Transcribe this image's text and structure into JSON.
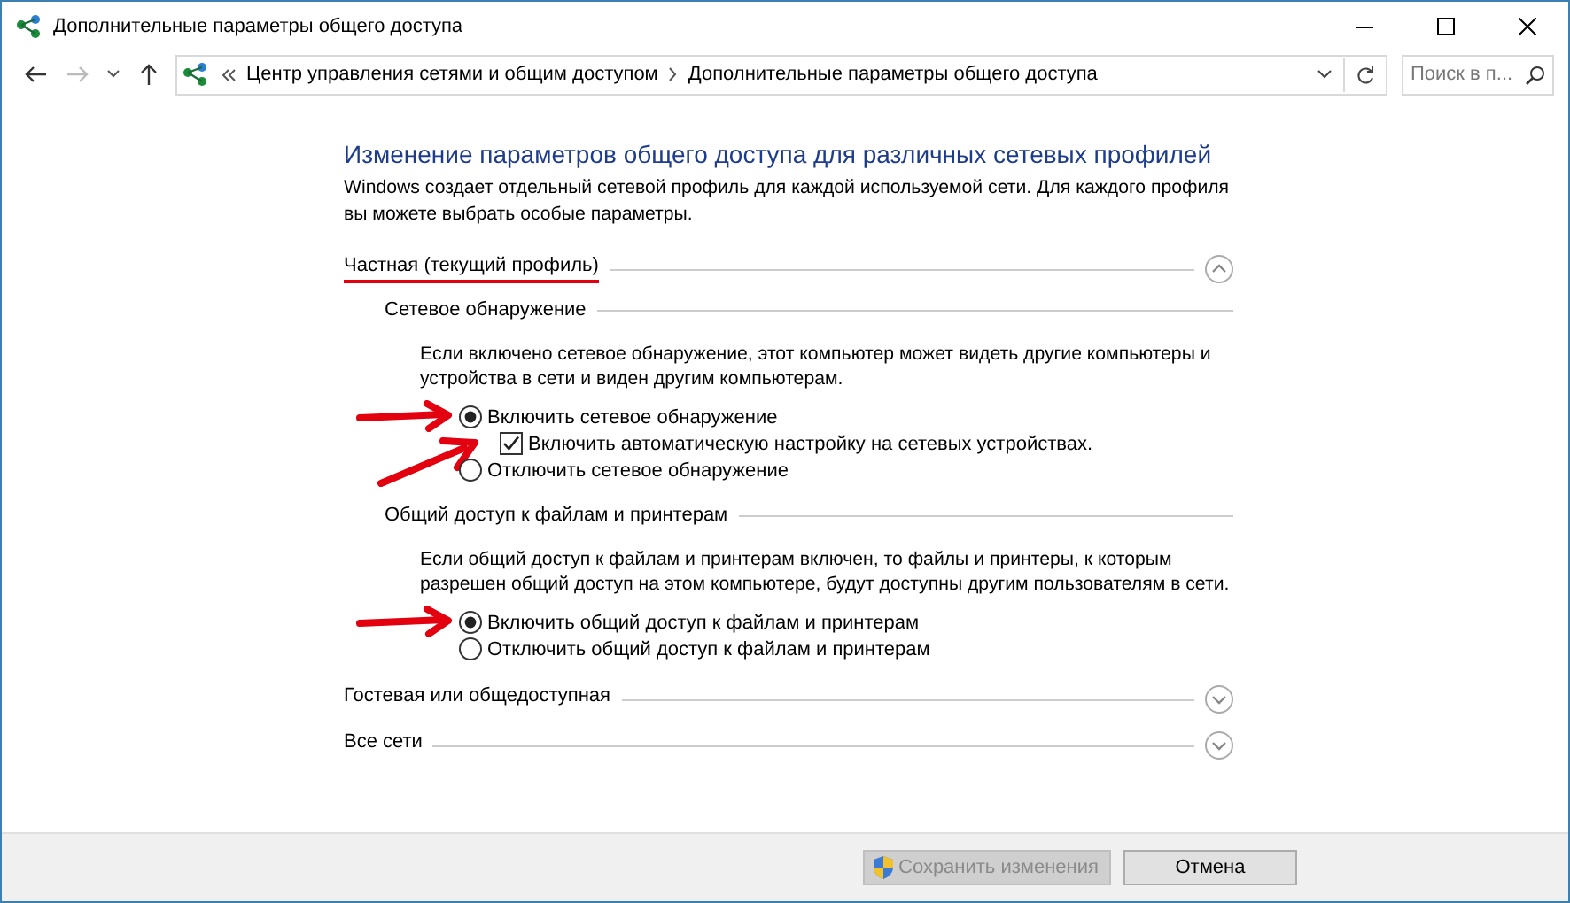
{
  "window": {
    "title": "Дополнительные параметры общего доступа"
  },
  "nav": {
    "back_enabled": true,
    "forward_enabled": false
  },
  "address": {
    "crumbs": [
      "Центр управления сетями и общим доступом",
      "Дополнительные параметры общего доступа"
    ]
  },
  "search": {
    "placeholder": "Поиск в п..."
  },
  "heading": "Изменение параметров общего доступа для различных сетевых профилей",
  "intro": "Windows создает отдельный сетевой профиль для каждой используемой сети. Для каждого профиля вы можете выбрать особые параметры.",
  "profiles": [
    {
      "title": "Частная (текущий профиль)",
      "expanded": true,
      "underlined": true,
      "sections": [
        {
          "title": "Сетевое обнаружение",
          "description": "Если включено сетевое обнаружение, этот компьютер может видеть другие компьютеры и устройства в сети и виден другим компьютерам.",
          "options": [
            {
              "kind": "radio",
              "label": "Включить сетевое обнаружение",
              "selected": true,
              "arrow": true,
              "children": [
                {
                  "kind": "checkbox",
                  "label": "Включить автоматическую настройку на сетевых устройствах.",
                  "checked": true,
                  "arrow": true
                }
              ]
            },
            {
              "kind": "radio",
              "label": "Отключить сетевое обнаружение",
              "selected": false,
              "arrow": false
            }
          ]
        },
        {
          "title": "Общий доступ к файлам и принтерам",
          "description": "Если общий доступ к файлам и принтерам включен, то файлы и принтеры, к которым разрешен общий доступ на этом компьютере, будут доступны другим пользователям в сети.",
          "options": [
            {
              "kind": "radio",
              "label": "Включить общий доступ к файлам и принтерам",
              "selected": true,
              "arrow": true
            },
            {
              "kind": "radio",
              "label": "Отключить общий доступ к файлам и принтерам",
              "selected": false,
              "arrow": false
            }
          ]
        }
      ]
    },
    {
      "title": "Гостевая или общедоступная",
      "expanded": false,
      "underlined": false
    },
    {
      "title": "Все сети",
      "expanded": false,
      "underlined": false
    }
  ],
  "buttons": [
    {
      "label": "Сохранить изменения",
      "disabled": true,
      "shield": true
    },
    {
      "label": "Отмена",
      "disabled": false,
      "shield": false
    }
  ]
}
